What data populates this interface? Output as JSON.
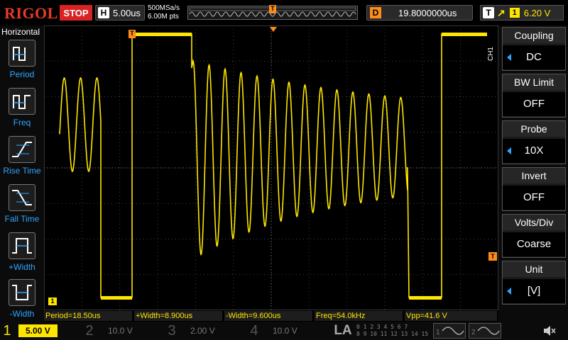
{
  "top": {
    "logo": "RIGOL",
    "run_state": "STOP",
    "timebase_key": "H",
    "timebase": "5.00us",
    "sample_rate": "500MSa/s",
    "memory_depth": "6.00M pts",
    "trigger_pos_marker": "T",
    "delay_key": "D",
    "delay": "19.8000000us",
    "trigger_key": "T",
    "trigger_channel": "1",
    "trigger_level": "6.20 V"
  },
  "left_panel": {
    "title": "Horizontal",
    "items": [
      {
        "label": "Period",
        "icon": "period-icon"
      },
      {
        "label": "Freq",
        "icon": "freq-icon"
      },
      {
        "label": "Rise Time",
        "icon": "rise-time-icon"
      },
      {
        "label": "Fall Time",
        "icon": "fall-time-icon"
      },
      {
        "label": "+Width",
        "icon": "positive-width-icon"
      },
      {
        "label": "-Width",
        "icon": "negative-width-icon"
      }
    ]
  },
  "right_panel": {
    "channel_tag": "CH1",
    "items": [
      {
        "title": "Coupling",
        "value": "DC",
        "has_arrow": true
      },
      {
        "title": "BW Limit",
        "value": "OFF",
        "has_arrow": false
      },
      {
        "title": "Probe",
        "value": "10X",
        "has_arrow": true
      },
      {
        "title": "Invert",
        "value": "OFF",
        "has_arrow": false
      },
      {
        "title": "Volts/Div",
        "value": "Coarse",
        "has_arrow": false
      },
      {
        "title": "Unit",
        "value": "[V]",
        "has_arrow": true
      }
    ]
  },
  "measurements": [
    "Period=18.50us",
    "+Width=8.900us",
    "-Width=9.600us",
    "Freq=54.0kHz",
    "Vpp=41.6 V"
  ],
  "bottom": {
    "channels": [
      {
        "num": "1",
        "scale": "5.00 V",
        "active": true
      },
      {
        "num": "2",
        "scale": "10.0 V",
        "active": false
      },
      {
        "num": "3",
        "scale": "2.00 V",
        "active": false
      },
      {
        "num": "4",
        "scale": "10.0 V",
        "active": false
      }
    ],
    "la_label": "LA",
    "la_row1": "0 1 2 3  4 5 6 7",
    "la_row2": "8 9 10 11  12 13 14 15"
  },
  "markers": {
    "ch1_ground": "1",
    "trigger_level_marker": "T"
  },
  "colors": {
    "ch1": "#ffe600",
    "ch2": "#00e5ff",
    "ch3": "#ff40c0",
    "ch4": "#2f7bff",
    "accent_blue": "#2fa5ff",
    "stop_red": "#d82323",
    "trigger_orange": "#ff8c1a"
  }
}
